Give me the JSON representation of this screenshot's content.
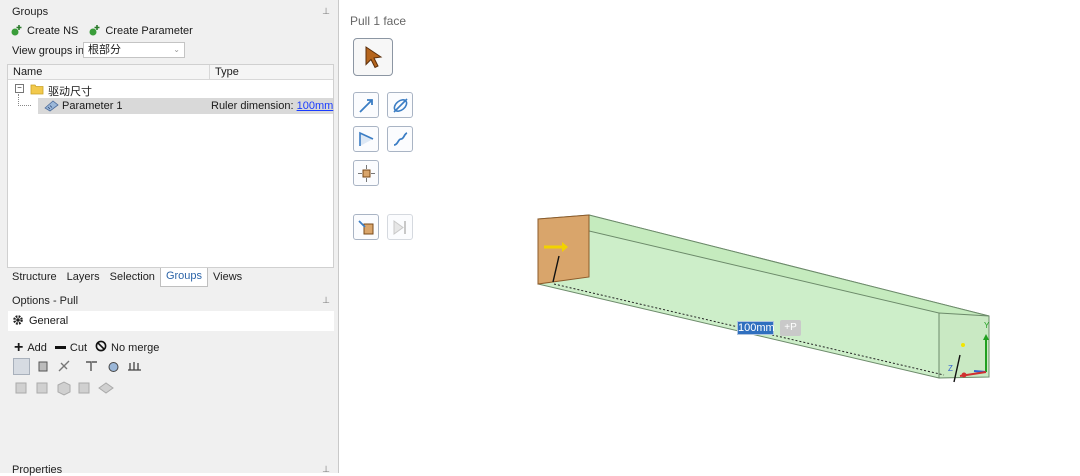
{
  "groups_panel": {
    "title": "Groups",
    "create_ns_label": "Create NS",
    "create_parameter_label": "Create Parameter",
    "view_groups_label": "View groups in:",
    "view_groups_value": "根部分",
    "columns": {
      "name": "Name",
      "type": "Type"
    },
    "tree": {
      "folder_label": "驱动尺寸",
      "param_label": "Parameter 1",
      "param_type_prefix": "Ruler dimension: ",
      "param_type_value": "100mm"
    }
  },
  "tabs": [
    "Structure",
    "Layers",
    "Selection",
    "Groups",
    "Views"
  ],
  "active_tab": "Groups",
  "options_panel": {
    "title": "Options - Pull",
    "section_label": "General",
    "add_label": "Add",
    "cut_label": "Cut",
    "no_merge_label": "No merge"
  },
  "properties_title": "Properties",
  "viewport": {
    "title": "Pull 1 face",
    "dimension_value": "100mm",
    "dimension_suffix": "+P"
  },
  "colors": {
    "accent": "#2f6fbf",
    "box_fill": "#cdeec9",
    "face_fill": "#d9a56b"
  },
  "icons": [
    "select-arrow-icon",
    "pull-direction-icon",
    "revolve-icon",
    "sweep-icon",
    "blend-icon",
    "pivot-icon",
    "up-to-icon",
    "full-pull-icon",
    "gear-icon",
    "plus-icon",
    "minus-icon",
    "no-merge-icon"
  ]
}
